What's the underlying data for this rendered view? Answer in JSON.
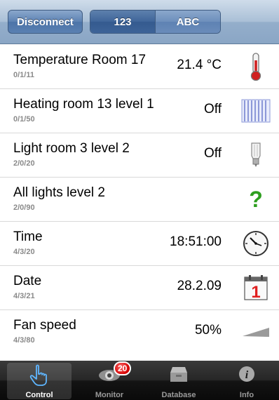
{
  "toolbar": {
    "disconnect_label": "Disconnect",
    "segments": [
      "123",
      "ABC"
    ],
    "selected_segment": "123"
  },
  "rows": [
    {
      "name": "Temperature Room 17",
      "address": "0/1/11",
      "value": "21.4 °C",
      "icon": "thermometer-icon"
    },
    {
      "name": "Heating room 13 level 1",
      "address": "0/1/50",
      "value": "Off",
      "icon": "radiator-icon"
    },
    {
      "name": "Light room 3 level 2",
      "address": "2/0/20",
      "value": "Off",
      "icon": "light-bulb-icon"
    },
    {
      "name": "All lights level 2",
      "address": "2/0/90",
      "value": "",
      "icon": "question-mark-icon"
    },
    {
      "name": "Time",
      "address": "4/3/20",
      "value": "18:51:00",
      "icon": "clock-icon"
    },
    {
      "name": "Date",
      "address": "4/3/21",
      "value": "28.2.09",
      "icon": "calendar-icon"
    },
    {
      "name": "Fan speed",
      "address": "4/3/80",
      "value": "50%",
      "icon": "level-wedge-icon"
    }
  ],
  "calendar_day": "1",
  "tabs": [
    {
      "label": "Control",
      "icon": "hand-pointer-icon",
      "selected": true
    },
    {
      "label": "Monitor",
      "icon": "eye-icon",
      "badge": "20"
    },
    {
      "label": "Database",
      "icon": "archive-box-icon"
    },
    {
      "label": "Info",
      "icon": "info-icon"
    }
  ],
  "colors": {
    "toolbar": "#a9bfd6",
    "button": "#5d82b3",
    "question_mark": "#2e9e1f",
    "calendar_red": "#e02020",
    "badge": "#d40000"
  }
}
